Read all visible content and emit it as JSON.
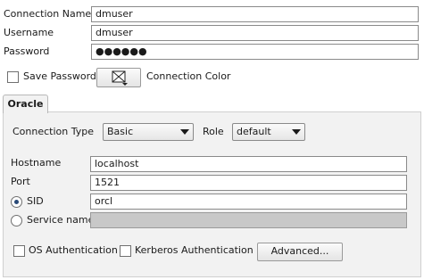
{
  "connection": {
    "name_label": "Connection Name",
    "name_value": "dmuser",
    "username_label": "Username",
    "username_value": "dmuser",
    "password_label": "Password",
    "password_value": "●●●●●●",
    "save_password_label": "Save Password",
    "save_password_checked": false,
    "color_label": "Connection Color"
  },
  "tabs": [
    {
      "label": "Oracle",
      "selected": true
    }
  ],
  "oracle": {
    "connection_type_label": "Connection Type",
    "connection_type_value": "Basic",
    "role_label": "Role",
    "role_value": "default",
    "hostname_label": "Hostname",
    "hostname_value": "localhost",
    "port_label": "Port",
    "port_value": "1521",
    "sid_label": "SID",
    "sid_value": "orcl",
    "sid_selected": true,
    "service_name_label": "Service name",
    "service_name_value": "",
    "os_auth_label": "OS Authentication",
    "os_auth_checked": false,
    "kerberos_label": "Kerberos Authentication",
    "kerberos_checked": false,
    "advanced_button": "Advanced..."
  },
  "icons": {
    "color_button": "color-swatch-icon",
    "dropdown_arrow": "chevron-down-icon"
  },
  "colors": {
    "panel_background": "#f2f2f2",
    "disabled_field": "#c8c8c8"
  }
}
